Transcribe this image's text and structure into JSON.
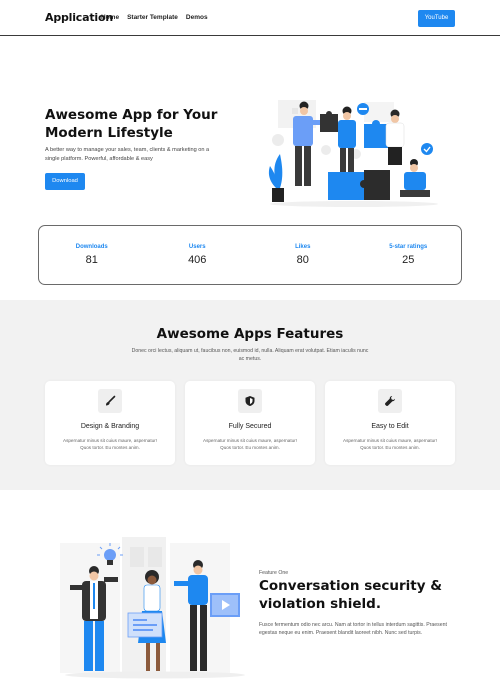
{
  "nav": {
    "brand": "Application",
    "links": [
      "Home",
      "Starter Template",
      "Demos"
    ],
    "youtube_label": "YouTube"
  },
  "hero": {
    "title": "Awesome App for Your Modern Lifestyle",
    "subtitle": "A better way to manage your sales, team, clients & marketing on a single platform. Powerful, affordable & easy",
    "download_label": "Download"
  },
  "stats": [
    {
      "label": "Downloads",
      "value": "81"
    },
    {
      "label": "Users",
      "value": "406"
    },
    {
      "label": "Likes",
      "value": "80"
    },
    {
      "label": "5-star ratings",
      "value": "25"
    }
  ],
  "features": {
    "title": "Awesome Apps Features",
    "subtitle": "Donec orci lectus, aliquam ut, faucibus non, euismod id, nulla. Aliquam erat volutpat. Etiam iaculis nunc ac metus.",
    "cards": [
      {
        "icon": "brush-icon",
        "title": "Design & Branding",
        "desc": "Aspernatur minus sit cuius maure, aspernatur! Quos tortor. Eu montes anim."
      },
      {
        "icon": "shield-icon",
        "title": "Fully Secured",
        "desc": "Aspernatur minus sit cuius maure, aspernatur! Quos tortor. Eu montes anim."
      },
      {
        "icon": "wrench-icon",
        "title": "Easy to Edit",
        "desc": "Aspernatur minus sit cuius maure, aspernatur! Quos tortor. Eu montes anim."
      }
    ]
  },
  "feature_one": {
    "kicker": "Feature One",
    "title": "Conversation security & violation shield.",
    "desc": "Fusce fermentum odio nec arcu. Nam at tortor in tellus interdum sagittis. Praesent egestas neque eu enim. Praesent blandit laoreet nibh. Nunc sed turpis."
  },
  "colors": {
    "accent": "#1e88f0",
    "dark": "#2d2d2d",
    "section_bg": "#f2f2f2"
  }
}
